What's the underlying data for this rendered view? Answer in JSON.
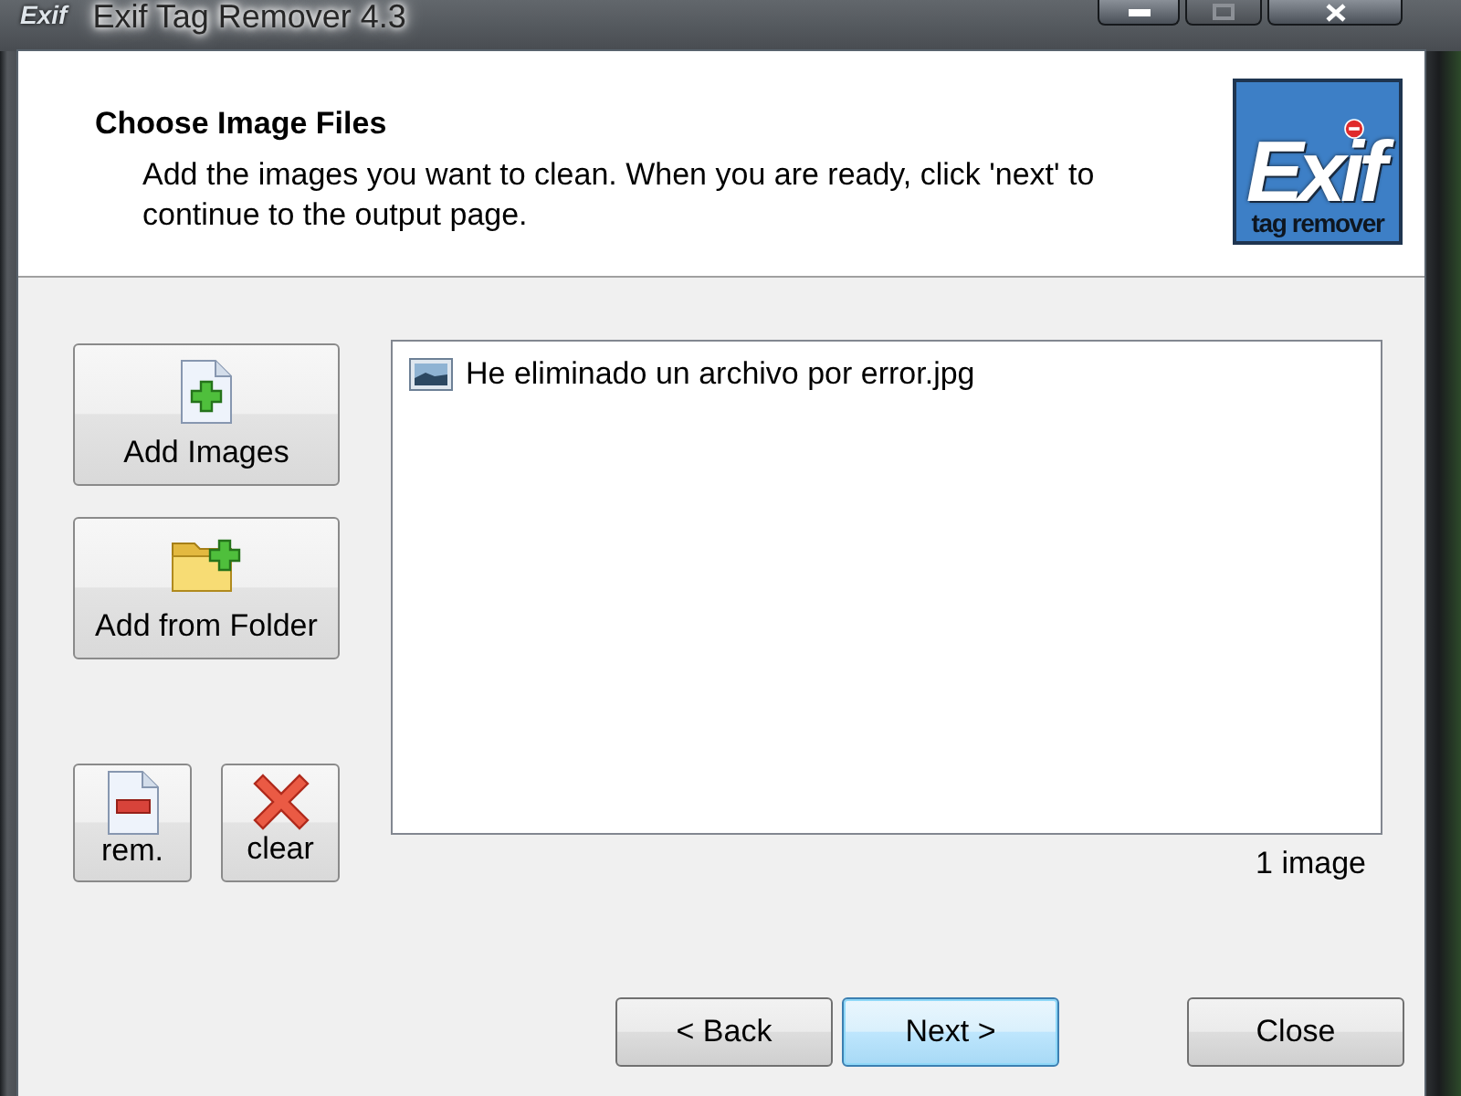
{
  "window": {
    "icon_text": "Exif",
    "title": "Exif Tag Remover 4.3",
    "controls": [
      {
        "kind": "minimize",
        "disabled": false
      },
      {
        "kind": "maximize",
        "disabled": true
      },
      {
        "kind": "close",
        "disabled": false
      }
    ]
  },
  "header": {
    "title": "Choose Image Files",
    "description": "Add the images you want to clean. When you are ready, click 'next' to continue to the output page.",
    "logo": {
      "text": "Exif",
      "subtext": "tag remover"
    }
  },
  "main_buttons": [
    {
      "label": "Add Images",
      "kind": "add-file"
    },
    {
      "label": "Add from Folder",
      "kind": "add-folder"
    }
  ],
  "small_buttons": [
    {
      "label": "rem.",
      "kind": "remove"
    },
    {
      "label": "clear",
      "kind": "clear"
    }
  ],
  "file_list": {
    "items": [
      {
        "name": "He eliminado un archivo por error.jpg",
        "selected": false
      }
    ],
    "count": "1 image"
  },
  "nav_buttons": [
    {
      "label": "< Back",
      "focused": false
    },
    {
      "label": "Next >",
      "focused": true
    }
  ],
  "close_button": {
    "label": "Close",
    "focused": false
  }
}
